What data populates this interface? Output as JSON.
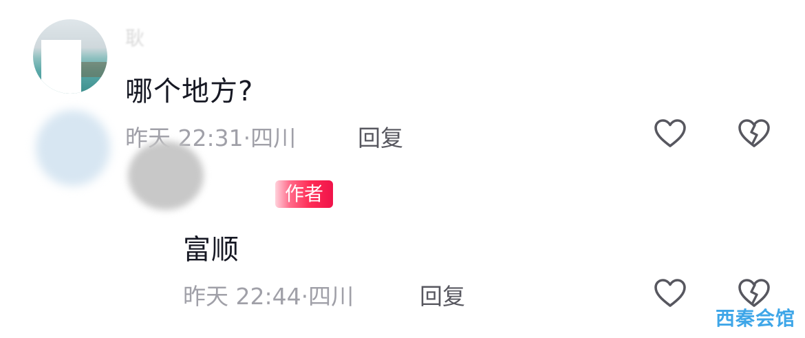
{
  "comment": {
    "author_name": "耿",
    "content": "哪个地方?",
    "time": "昨天 22:31",
    "location": "四川",
    "reply_label": "回复",
    "like_icon": "heart-outline-icon",
    "dislike_icon": "broken-heart-icon"
  },
  "reply": {
    "badge": "作者",
    "content": "富顺",
    "time": "昨天 22:44",
    "location": "四川",
    "reply_label": "回复",
    "like_icon": "heart-outline-icon",
    "dislike_icon": "broken-heart-icon"
  },
  "watermark": "西秦会馆",
  "colors": {
    "text_primary": "#161823",
    "text_secondary": "#a0a0a8",
    "author_badge": "#fe2c55",
    "icon": "#57575f",
    "watermark": "#3ea6e8"
  }
}
